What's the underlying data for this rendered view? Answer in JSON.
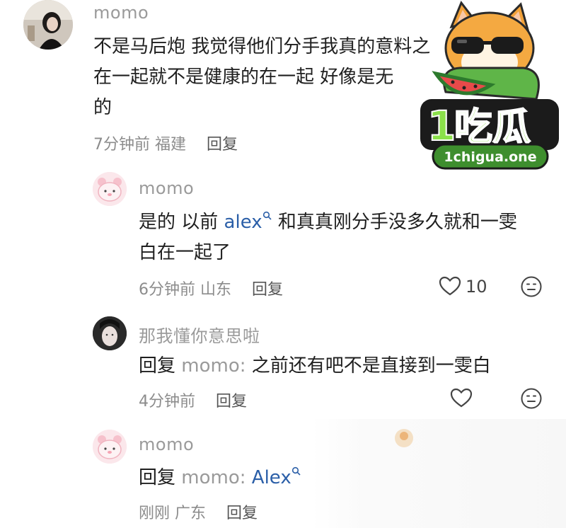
{
  "comments": [
    {
      "username": "momo",
      "text_lines": [
        "不是马后炮 我觉得他们分手我真的意料之",
        "在一起就不是健康的在一起 好像是无",
        "的"
      ],
      "time": "7分钟前",
      "location": "福建",
      "reply_label": "回复"
    },
    {
      "username": "momo",
      "text_a": "是的 以前 ",
      "mention": "alex",
      "text_b": " 和真真刚分手没多久就和一雯",
      "text_line2": "白在一起了",
      "time": "6分钟前",
      "location": "山东",
      "reply_label": "回复",
      "likes": "10"
    },
    {
      "username": "那我懂你意思啦",
      "reply_prefix": "回复",
      "reply_to": "momo:",
      "text": " 之前还有吧不是直接到一雯白",
      "time": "4分钟前",
      "reply_label": "回复"
    },
    {
      "username": "momo",
      "reply_prefix": "回复",
      "reply_to": "momo:",
      "mention": "Alex",
      "time": "刚刚",
      "location": "广东",
      "reply_label": "回复"
    }
  ],
  "watermark": {
    "number": "1",
    "title": "吃瓜",
    "domain": "1chigua.one"
  },
  "colors": {
    "mention": "#2b5fa8",
    "meta": "#8c8c8c",
    "username": "#9a9a9a"
  },
  "icons": [
    "heart-icon",
    "emoji-icon",
    "search-mark-icon"
  ]
}
